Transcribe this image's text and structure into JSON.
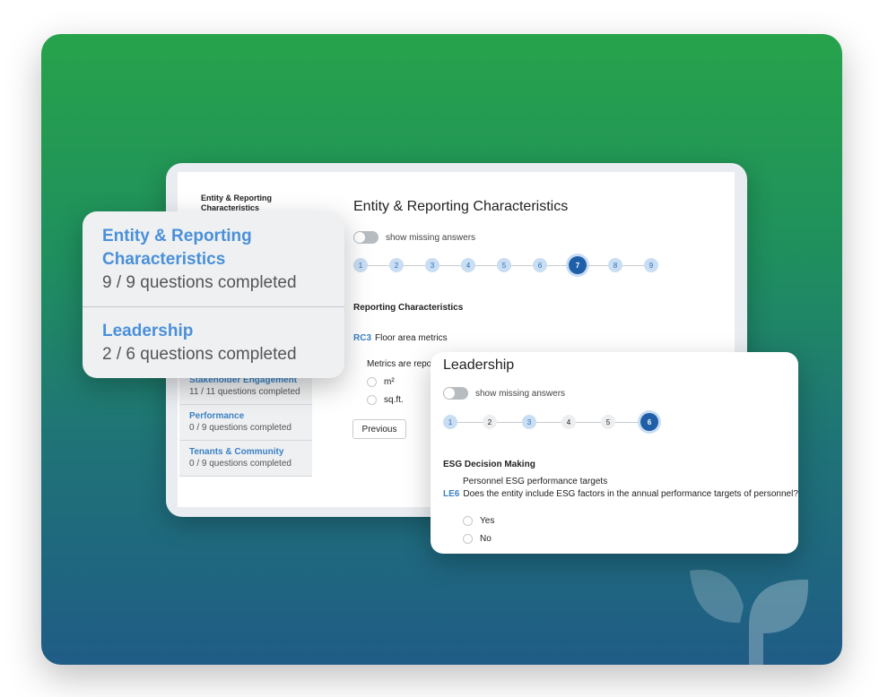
{
  "background": {
    "gradient_top": "#27a34b",
    "gradient_bottom": "#1f5c86",
    "accent": "#3b82c4"
  },
  "tablet": {
    "left_title": "Entity & Reporting Characteristics",
    "main_title": "Entity & Reporting Characteristics",
    "toggle_label": "show missing answers",
    "steps": [
      "1",
      "2",
      "3",
      "4",
      "5",
      "6",
      "7",
      "8",
      "9"
    ],
    "active_step": "7",
    "section_title": "Reporting Characteristics",
    "question": {
      "code": "RC3",
      "text": "Floor area metrics"
    },
    "metrics_label": "Metrics are repo",
    "options": [
      "m²",
      "sq.ft."
    ],
    "previous_button": "Previous",
    "sidebar": [
      {
        "title": "Stakeholder Engagement",
        "subtitle": "11 / 11 questions completed"
      },
      {
        "title": "Performance",
        "subtitle": "0 / 9 questions completed"
      },
      {
        "title": "Tenants & Community",
        "subtitle": "0 / 9 questions completed"
      }
    ]
  },
  "summary_card": {
    "items": [
      {
        "title": "Entity & Reporting Characteristics",
        "subtitle": "9 / 9 questions completed"
      },
      {
        "title": "Leadership",
        "subtitle": "2 / 6 questions completed"
      }
    ]
  },
  "leadership_card": {
    "title": "Leadership",
    "toggle_label": "show missing answers",
    "steps": [
      "1",
      "2",
      "3",
      "4",
      "5",
      "6"
    ],
    "active_step": "6",
    "section_title": "ESG Decision Making",
    "question_subtitle": "Personnel ESG performance targets",
    "question": {
      "code": "LE6",
      "text": "Does the entity include ESG factors in the annual performance targets of personnel?"
    },
    "options": [
      "Yes",
      "No"
    ]
  }
}
